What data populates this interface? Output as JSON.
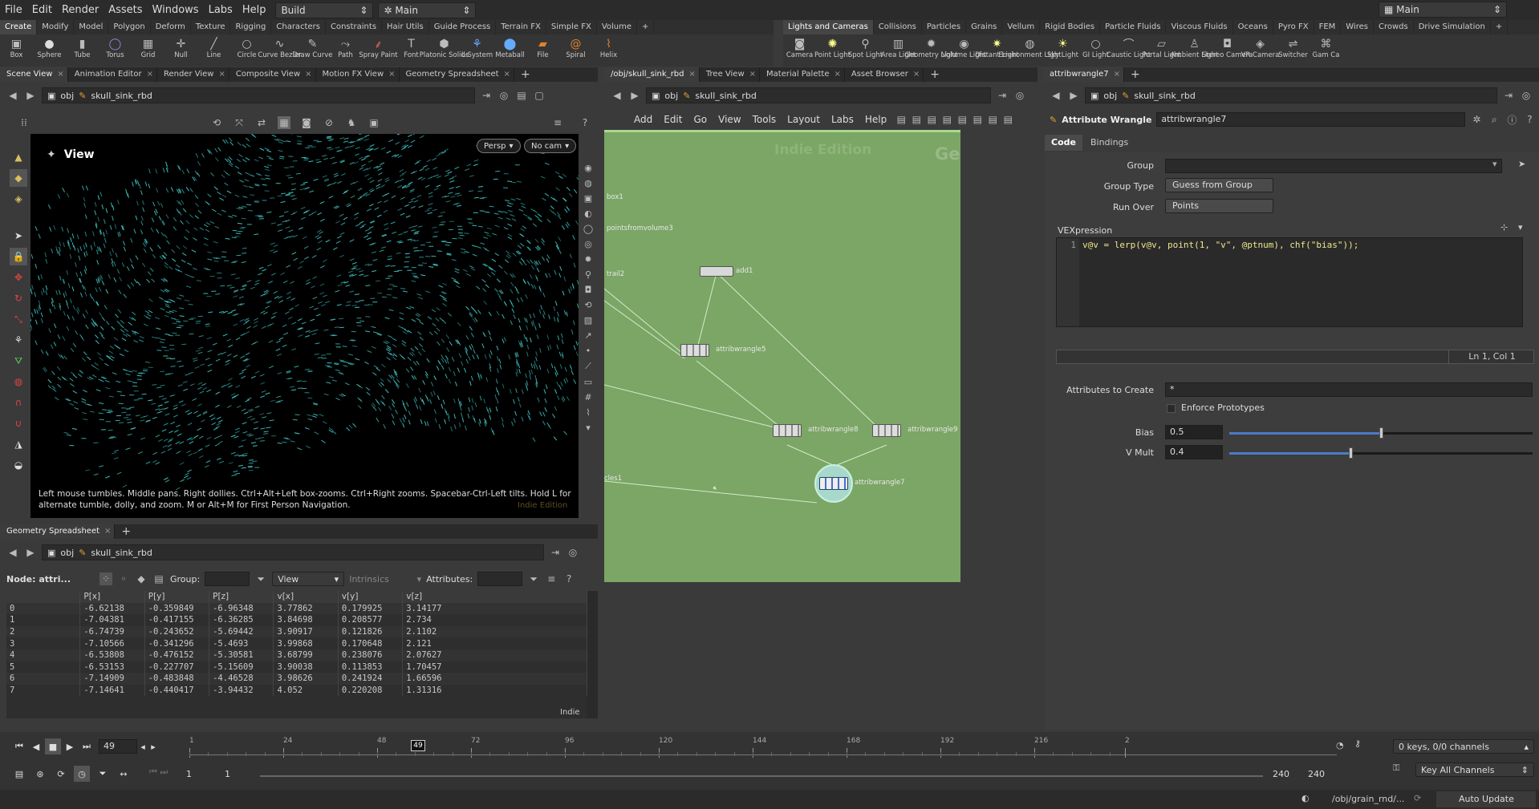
{
  "menubar": {
    "items": [
      "File",
      "Edit",
      "Render",
      "Assets",
      "Windows",
      "Labs",
      "Help"
    ],
    "desktop": "Build",
    "context": "Main",
    "desktop_right": "Main"
  },
  "shelf_left": {
    "tabs": [
      "Create",
      "Modify",
      "Model",
      "Polygon",
      "Deform",
      "Texture",
      "Rigging",
      "Characters",
      "Constraints",
      "Hair Utils",
      "Guide Process",
      "Terrain FX",
      "Simple FX",
      "Volume"
    ],
    "tools": [
      {
        "label": "Box",
        "icon": "box-icon"
      },
      {
        "label": "Sphere",
        "icon": "sphere-icon"
      },
      {
        "label": "Tube",
        "icon": "tube-icon"
      },
      {
        "label": "Torus",
        "icon": "torus-icon"
      },
      {
        "label": "Grid",
        "icon": "grid-icon"
      },
      {
        "label": "Null",
        "icon": "null-icon"
      },
      {
        "label": "Line",
        "icon": "line-icon"
      },
      {
        "label": "Circle",
        "icon": "circle-icon"
      },
      {
        "label": "Curve Bezier",
        "icon": "curve-bezier-icon"
      },
      {
        "label": "Draw Curve",
        "icon": "draw-curve-icon"
      },
      {
        "label": "Path",
        "icon": "path-icon"
      },
      {
        "label": "Spray Paint",
        "icon": "spray-paint-icon"
      },
      {
        "label": "Font",
        "icon": "font-icon"
      },
      {
        "label": "Platonic Solids",
        "icon": "platonic-icon"
      },
      {
        "label": "L-System",
        "icon": "lsystem-icon"
      },
      {
        "label": "Metaball",
        "icon": "metaball-icon"
      },
      {
        "label": "File",
        "icon": "file-icon"
      },
      {
        "label": "Spiral",
        "icon": "spiral-icon"
      },
      {
        "label": "Helix",
        "icon": "helix-icon"
      }
    ]
  },
  "shelf_right": {
    "tabs": [
      "Lights and Cameras",
      "Collisions",
      "Particles",
      "Grains",
      "Vellum",
      "Rigid Bodies",
      "Particle Fluids",
      "Viscous Fluids",
      "Oceans",
      "Pyro FX",
      "FEM",
      "Wires",
      "Crowds",
      "Drive Simulation"
    ],
    "tools": [
      {
        "label": "Camera",
        "icon": "camera-icon"
      },
      {
        "label": "Point Light",
        "icon": "point-light-icon"
      },
      {
        "label": "Spot Light",
        "icon": "spot-light-icon"
      },
      {
        "label": "Area Light",
        "icon": "area-light-icon"
      },
      {
        "label": "Geometry Light",
        "icon": "geometry-light-icon"
      },
      {
        "label": "Volume Light",
        "icon": "volume-light-icon"
      },
      {
        "label": "Distant Light",
        "icon": "distant-light-icon"
      },
      {
        "label": "Environment Light",
        "icon": "environment-light-icon"
      },
      {
        "label": "Sky Light",
        "icon": "sky-light-icon"
      },
      {
        "label": "GI Light",
        "icon": "gi-light-icon"
      },
      {
        "label": "Caustic Light",
        "icon": "caustic-light-icon"
      },
      {
        "label": "Portal Light",
        "icon": "portal-light-icon"
      },
      {
        "label": "Ambient Light",
        "icon": "ambient-light-icon"
      },
      {
        "label": "Stereo Camera",
        "icon": "stereo-camera-icon"
      },
      {
        "label": "VR Camera",
        "icon": "vr-camera-icon"
      },
      {
        "label": "Switcher",
        "icon": "switcher-icon"
      },
      {
        "label": "Gam Ca",
        "icon": "gamepad-camera-icon"
      }
    ]
  },
  "left_pane": {
    "tabs": [
      "Scene View",
      "Animation Editor",
      "Render View",
      "Composite View",
      "Motion FX View",
      "Geometry Spreadsheet"
    ],
    "path_root": "obj",
    "path_node": "skull_sink_rbd",
    "view_title": "View",
    "persp": "Persp",
    "cam": "No cam",
    "hint": "Left mouse tumbles. Middle pans. Right dollies. Ctrl+Alt+Left box-zooms. Ctrl+Right zooms. Spacebar-Ctrl-Left tilts. Hold L for alternate tumble, dolly, and zoom. M or Alt+M for First Person Navigation.",
    "watermark": "Indie Edition"
  },
  "spreadsheet": {
    "tab": "Geometry Spreadsheet",
    "path_root": "obj",
    "path_node": "skull_sink_rbd",
    "node_label": "Node: attri...",
    "group_label": "Group:",
    "view_label": "View",
    "intrinsics_label": "Intrinsics",
    "attributes_label": "Attributes:",
    "indie": "Indie",
    "columns": [
      "",
      "P[x]",
      "P[y]",
      "P[z]",
      "v[x]",
      "v[y]",
      "v[z]"
    ],
    "rows": [
      [
        "0",
        "-6.62138",
        "-0.359849",
        "-6.96348",
        "3.77862",
        "0.179925",
        "3.14177"
      ],
      [
        "1",
        "-7.04381",
        "-0.417155",
        "-6.36285",
        "3.84698",
        "0.208577",
        "2.734"
      ],
      [
        "2",
        "-6.74739",
        "-0.243652",
        "-5.69442",
        "3.90917",
        "0.121826",
        "2.1102"
      ],
      [
        "3",
        "-7.10566",
        "-0.341296",
        "-5.4693",
        "3.99868",
        "0.170648",
        "2.121"
      ],
      [
        "4",
        "-6.53808",
        "-0.476152",
        "-5.30581",
        "3.68799",
        "0.238076",
        "2.07627"
      ],
      [
        "5",
        "-6.53153",
        "-0.227707",
        "-5.15609",
        "3.90038",
        "0.113853",
        "1.70457"
      ],
      [
        "6",
        "-7.14909",
        "-0.483848",
        "-4.46528",
        "3.98626",
        "0.241924",
        "1.66596"
      ],
      [
        "7",
        "-7.14641",
        "-0.440417",
        "-3.94432",
        "4.052",
        "0.220208",
        "1.31316"
      ]
    ]
  },
  "network": {
    "tabs": [
      "/obj/skull_sink_rbd",
      "Tree View",
      "Material Palette",
      "Asset Browser"
    ],
    "path_root": "obj",
    "path_node": "skull_sink_rbd",
    "menu": [
      "Add",
      "Edit",
      "Go",
      "View",
      "Tools",
      "Layout",
      "Labs",
      "Help"
    ],
    "watermark": "Indie Edition",
    "context_label": "Geometry",
    "nodes": {
      "box1": "box1",
      "pfv": "pointsfromvolume3",
      "trail": "trail2",
      "add": "add1",
      "w5": "attribwrangle5",
      "w8": "attribwrangle8",
      "w9": "attribwrangle9",
      "w7": "attribwrangle7",
      "particles": "cles1"
    }
  },
  "params": {
    "tab": "attribwrangle7",
    "path_root": "obj",
    "path_node": "skull_sink_rbd",
    "node_type": "Attribute Wrangle",
    "node_name": "attribwrangle7",
    "subtabs": [
      "Code",
      "Bindings"
    ],
    "group_label": "Group",
    "group_value": "",
    "group_type_label": "Group Type",
    "group_type_value": "Guess from Group",
    "run_over_label": "Run Over",
    "run_over_value": "Points",
    "vex_label": "VEXpression",
    "line_no": "1",
    "code": "v@v = lerp(v@v, point(1, \"v\", @ptnum), chf(\"bias\"));",
    "cursor": "Ln 1, Col 1",
    "attr_create_label": "Attributes to Create",
    "attr_create_value": "*",
    "enforce_label": "Enforce Prototypes",
    "bias_label": "Bias",
    "bias_value": "0.5",
    "bias_fraction": 0.5,
    "vmult_label": "V Mult",
    "vmult_value": "0.4",
    "vmult_fraction": 0.4
  },
  "timeline": {
    "frame": "49",
    "ticks": [
      "1",
      "24",
      "48",
      "72",
      "96",
      "120",
      "144",
      "168",
      "192",
      "216",
      "2"
    ],
    "marker": "49",
    "start": "1",
    "start2": "1",
    "end": "240",
    "end2": "240",
    "keys": "0 keys, 0/0 channels",
    "key_all": "Key All Channels"
  },
  "statusbar": {
    "path": "/obj/grain_rnd/...",
    "update": "Auto Update"
  },
  "colors": {
    "particle": "#3fc7c7",
    "network_bg": "#7ba665",
    "slider": "#4a7bc8"
  }
}
